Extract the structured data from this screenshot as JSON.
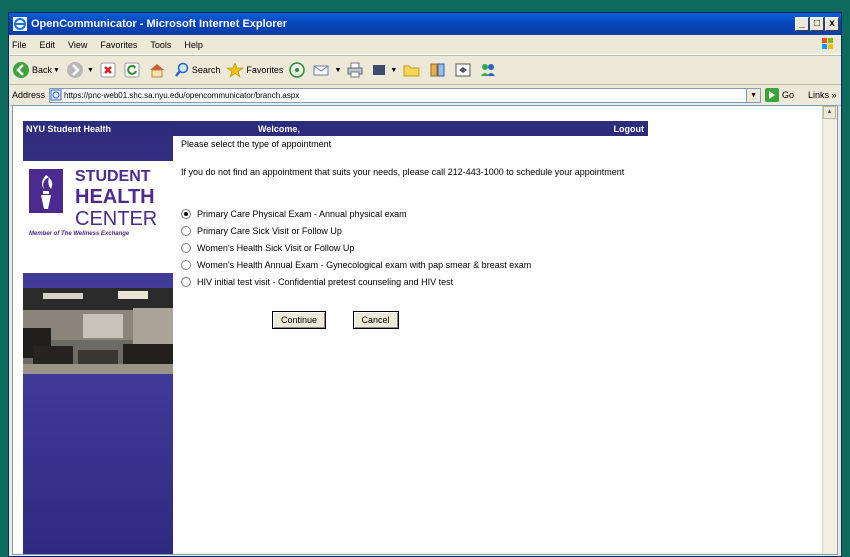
{
  "window": {
    "title": "OpenCommunicator - Microsoft Internet Explorer",
    "buttons": [
      "_",
      "□",
      "x"
    ]
  },
  "menu": [
    "File",
    "Edit",
    "View",
    "Favorites",
    "Tools",
    "Help"
  ],
  "toolbar": {
    "back": "Back",
    "search": "Search",
    "favorites": "Favorites"
  },
  "address": {
    "label": "Address",
    "url": "https://pnc-web01.shc.sa.nyu.edu/opencommunicator/branch.aspx",
    "go": "Go",
    "links": "Links »"
  },
  "page": {
    "site_name": "NYU Student Health",
    "welcome": "Welcome,",
    "logout": "Logout",
    "logo": {
      "line1": "STUDENT",
      "line2": "HEALTH",
      "line3": "CENTER",
      "tagline": "Member of The Wellness Exchange"
    },
    "prompt": "Please select the type of appointment",
    "info": "If you do not find an appointment that suits your needs, please call 212-443-1000 to schedule your appointment",
    "options": [
      {
        "label": "Primary Care Physical Exam - Annual physical exam",
        "checked": true
      },
      {
        "label": "Primary Care Sick Visit or Follow Up",
        "checked": false
      },
      {
        "label": "Women's Health Sick Visit or Follow Up",
        "checked": false
      },
      {
        "label": "Women's Health Annual Exam - Gynecological exam with pap smear & breast exam",
        "checked": false
      },
      {
        "label": "HIV initial test visit - Confidential pretest counseling and HIV test",
        "checked": false
      }
    ],
    "continue_label": "Continue",
    "cancel_label": "Cancel"
  }
}
